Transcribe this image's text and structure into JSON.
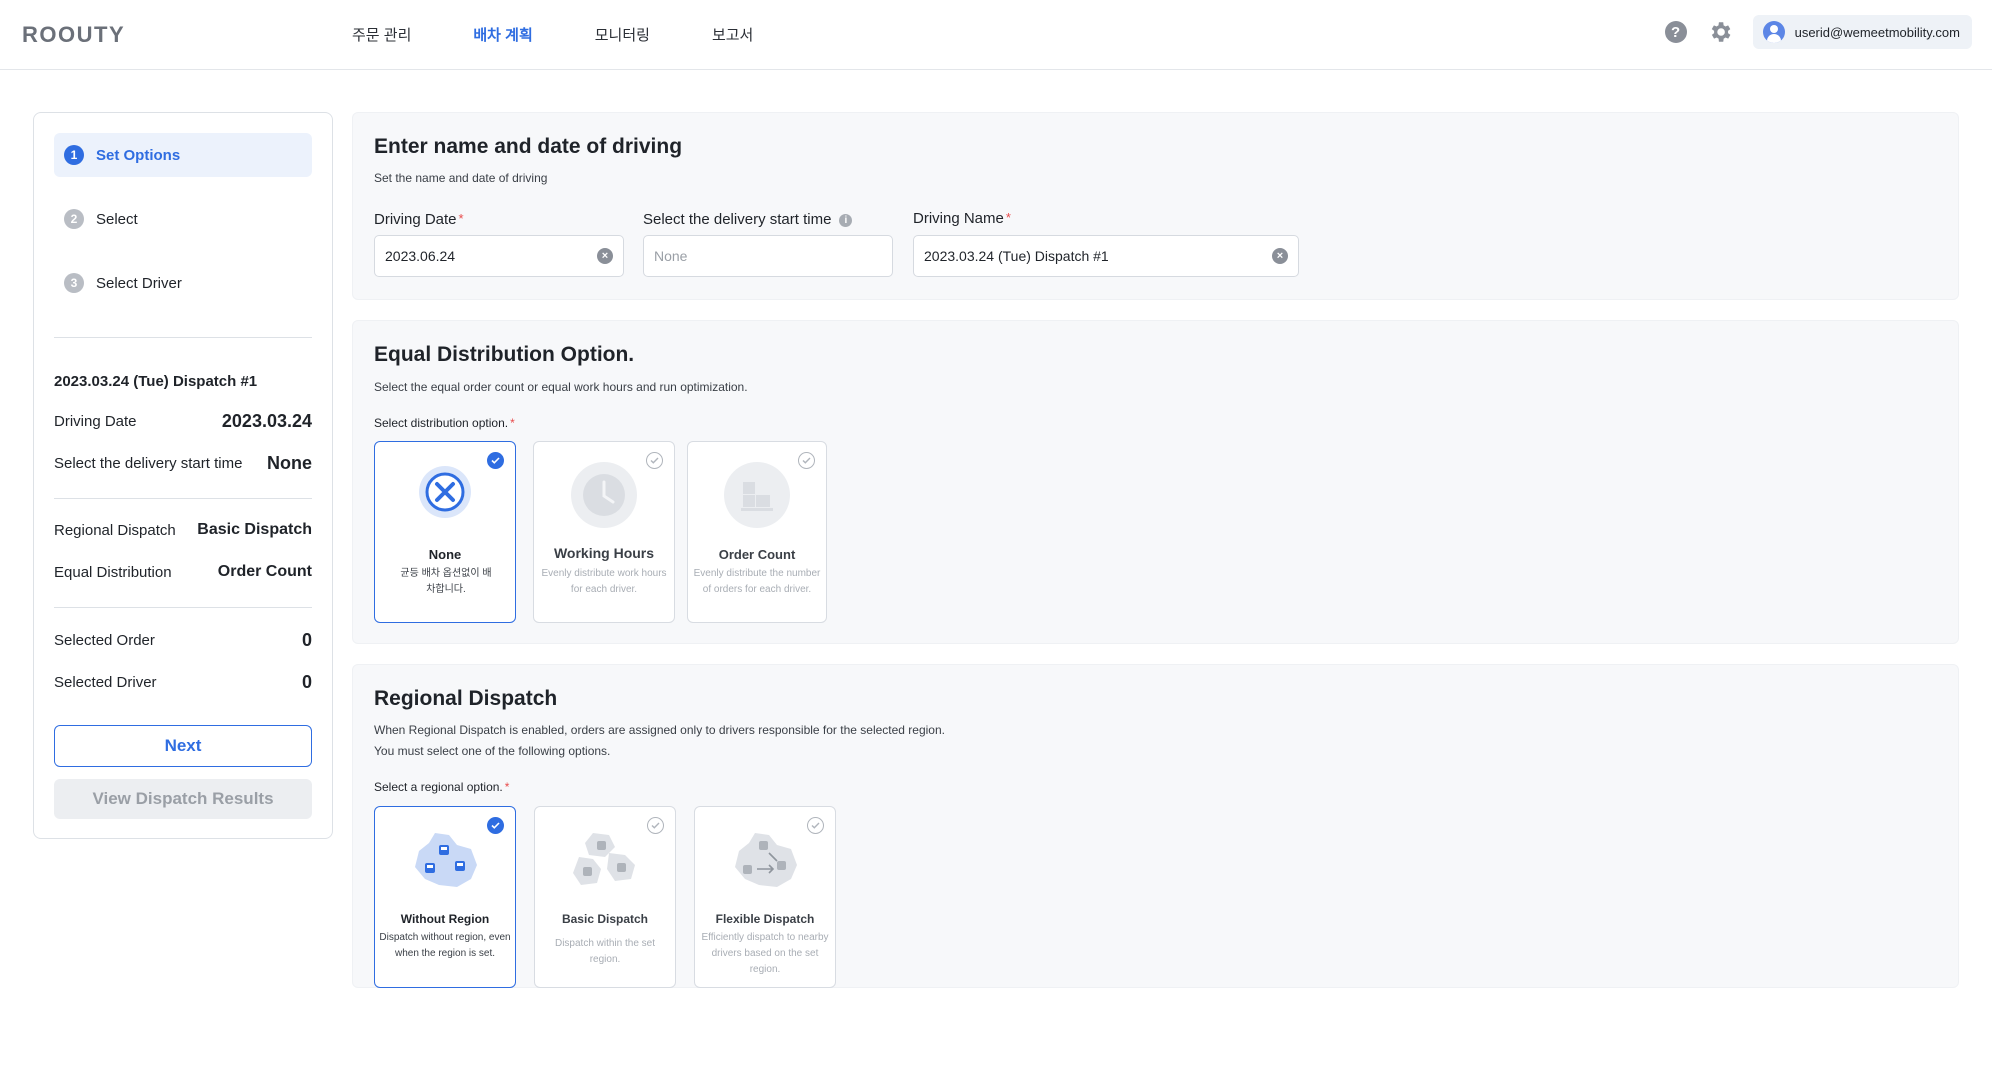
{
  "header": {
    "logo": "ROOUTY",
    "nav": [
      "주문 관리",
      "배차 계획",
      "모니터링",
      "보고서"
    ],
    "active_nav_index": 1,
    "user_email": "userid@wemeetmobility.com"
  },
  "sidebar": {
    "steps": [
      {
        "num": "1",
        "label": "Set Options",
        "active": true
      },
      {
        "num": "2",
        "label": "Select",
        "active": false
      },
      {
        "num": "3",
        "label": "Select Driver",
        "active": false
      }
    ],
    "dispatch_name": "2023.03.24 (Tue) Dispatch #1",
    "summary": [
      {
        "key": "Driving Date",
        "value": "2023.03.24"
      },
      {
        "key": "Select the delivery start time",
        "value": "None"
      }
    ],
    "options": [
      {
        "key": "Regional Dispatch",
        "value": "Basic Dispatch"
      },
      {
        "key": "Equal Distribution",
        "value": "Order Count"
      }
    ],
    "counts": [
      {
        "key": "Selected Order",
        "value": "0"
      },
      {
        "key": "Selected Driver",
        "value": "0"
      }
    ],
    "next_label": "Next",
    "results_label": "View Dispatch Results"
  },
  "name_date": {
    "title": "Enter name and date of driving",
    "desc": "Set the name and date of driving",
    "driving_date_label": "Driving Date",
    "driving_date_value": "2023.06.24",
    "start_time_label": "Select the delivery start time",
    "start_time_placeholder": "None",
    "driving_name_label": "Driving Name",
    "driving_name_value": "2023.03.24 (Tue) Dispatch #1"
  },
  "equal_distribution": {
    "title": "Equal Distribution Option.",
    "desc": "Select the equal order count or equal work hours and run optimization.",
    "option_label": "Select distribution option.",
    "cards": [
      {
        "title": "None",
        "desc": "균등 배차 옵션없이 배차합니다.",
        "selected": true,
        "icon": "close-circle-icon"
      },
      {
        "title": "Working Hours",
        "desc": "Evenly distribute work hours for each driver.",
        "selected": false,
        "icon": "clock-icon"
      },
      {
        "title": "Order Count",
        "desc": "Evenly distribute the number of orders for each driver.",
        "selected": false,
        "icon": "boxes-icon"
      }
    ]
  },
  "regional_dispatch": {
    "title": "Regional Dispatch",
    "desc_line1": "When Regional Dispatch is enabled, orders are assigned only to drivers responsible for the selected region.",
    "desc_line2": "You must select one of the following options.",
    "option_label": "Select a regional option.",
    "cards": [
      {
        "title": "Without Region",
        "desc": "Dispatch without region, even when the region is set.",
        "selected": true,
        "icon": "region-map-icon"
      },
      {
        "title": "Basic Dispatch",
        "desc": "Dispatch within the set region.",
        "selected": false,
        "icon": "region-split-icon"
      },
      {
        "title": "Flexible Dispatch",
        "desc": "Efficiently dispatch to nearby drivers based on the set region.",
        "selected": false,
        "icon": "region-flex-icon"
      }
    ]
  },
  "colors": {
    "accent": "#2f6de1",
    "required": "#e84a4a",
    "section_bg": "#f7f8fa"
  }
}
